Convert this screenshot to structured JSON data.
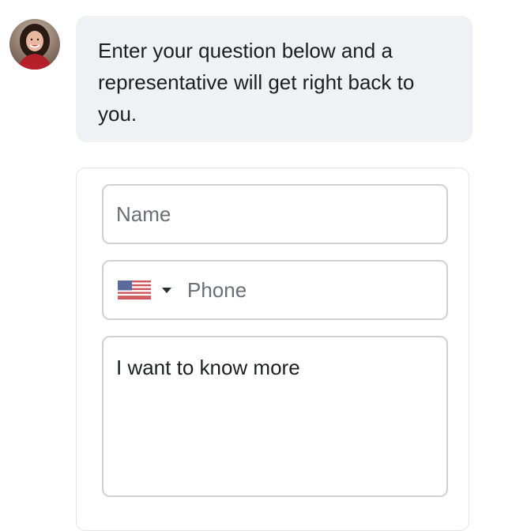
{
  "agent": {
    "avatar_icon": "agent-avatar-photo",
    "message": "Enter your question below and a representative will get right back to you."
  },
  "form": {
    "name": {
      "placeholder": "Name",
      "value": ""
    },
    "phone": {
      "country_flag_icon": "us-flag-icon",
      "placeholder": "Phone",
      "value": ""
    },
    "message": {
      "value": "I want to know more"
    }
  },
  "colors": {
    "bubble_bg": "#f0f1f5",
    "field_border": "#cfd1d6",
    "card_border": "#e3e4e8",
    "text": "#1c1e21",
    "placeholder": "#6b6e75"
  }
}
